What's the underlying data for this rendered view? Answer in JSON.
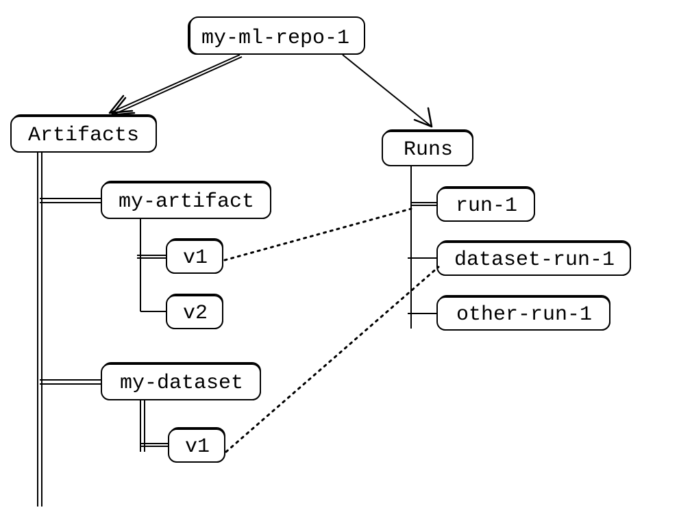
{
  "diagram": {
    "root": "my-ml-repo-1",
    "artifacts": {
      "label": "Artifacts",
      "items": [
        {
          "name": "my-artifact",
          "versions": [
            "v1",
            "v2"
          ]
        },
        {
          "name": "my-dataset",
          "versions": [
            "v1"
          ]
        }
      ]
    },
    "runs": {
      "label": "Runs",
      "items": [
        "run-1",
        "dataset-run-1",
        "other-run-1"
      ]
    },
    "links": [
      {
        "from": "my-artifact/v1",
        "to": "run-1"
      },
      {
        "from": "my-dataset/v1",
        "to": "dataset-run-1"
      }
    ]
  }
}
